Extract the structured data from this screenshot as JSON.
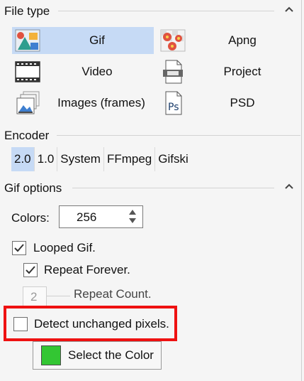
{
  "file_type": {
    "title": "File type",
    "collapse_icon": "chevron-up-icon",
    "options": [
      {
        "label": "Gif",
        "icon": "gif-image-icon",
        "selected": true
      },
      {
        "label": "Apng",
        "icon": "apng-flowers-icon",
        "selected": false
      },
      {
        "label": "Video",
        "icon": "film-strip-icon",
        "selected": false
      },
      {
        "label": "Project",
        "icon": "project-file-icon",
        "selected": false
      },
      {
        "label": "Images (frames)",
        "icon": "image-frames-icon",
        "selected": false
      },
      {
        "label": "PSD",
        "icon": "psd-file-icon",
        "selected": false
      }
    ]
  },
  "encoder": {
    "title": "Encoder",
    "options": [
      "2.0",
      "1.0",
      "System",
      "FFmpeg",
      "Gifski"
    ],
    "selected": "2.0"
  },
  "gif_options": {
    "title": "Gif options",
    "collapse_icon": "chevron-up-icon",
    "colors_label": "Colors:",
    "colors_value": "256",
    "looped_label": "Looped Gif.",
    "looped_checked": true,
    "repeat_forever_label": "Repeat Forever.",
    "repeat_forever_checked": true,
    "repeat_count_value": "2",
    "repeat_count_label": "Repeat Count.",
    "detect_unchanged_label": "Detect unchanged pixels.",
    "detect_unchanged_checked": false,
    "select_color_label": "Select the Color",
    "select_color_swatch": "#33c633",
    "highlight_color": "#ee1111"
  }
}
